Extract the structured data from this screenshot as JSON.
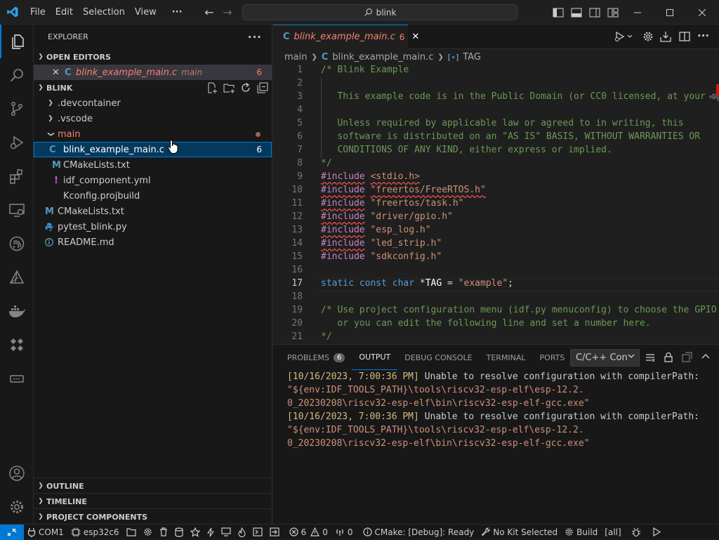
{
  "menu": {
    "file": "File",
    "edit": "Edit",
    "selection": "Selection",
    "view": "View",
    "more": "···"
  },
  "search": {
    "text": "blink"
  },
  "explorer": {
    "title": "EXPLORER",
    "open_editors": {
      "title": "OPEN EDITORS",
      "file": {
        "name": "blink_example_main.c",
        "folder": "main",
        "problems": "6"
      }
    },
    "folder": {
      "title": "BLINK"
    },
    "tree": [
      {
        "label": ".devcontainer"
      },
      {
        "label": ".vscode"
      },
      {
        "label": "main"
      },
      {
        "label": "blink_example_main.c",
        "badge": "6"
      },
      {
        "label": "CMakeLists.txt"
      },
      {
        "label": "idf_component.yml"
      },
      {
        "label": "Kconfig.projbuild"
      },
      {
        "label": "CMakeLists.txt"
      },
      {
        "label": "pytest_blink.py"
      },
      {
        "label": "README.md"
      }
    ],
    "outline": "OUTLINE",
    "timeline": "TIMELINE",
    "project_components": "PROJECT COMPONENTS"
  },
  "editor": {
    "tab": {
      "name": "blink_example_main.c",
      "problems": "6"
    },
    "breadcrumb": {
      "folder": "main",
      "file": "blink_example_main.c",
      "symbol": "TAG"
    },
    "line_numbers": [
      "1",
      "2",
      "3",
      "4",
      "5",
      "6",
      "7",
      "8",
      "9",
      "10",
      "11",
      "12",
      "13",
      "14",
      "15",
      "16",
      "17",
      "18",
      "19",
      "20",
      "21"
    ],
    "code": {
      "l1": "/* Blink Example",
      "l3": "   This example code is in the Public Domain (or CC0 licensed, at your option.)",
      "l5": "   Unless required by applicable law or agreed to in writing, this",
      "l6": "   software is distributed on an \"AS IS\" BASIS, WITHOUT WARRANTIES OR",
      "l7": "   CONDITIONS OF ANY KIND, either express or implied.",
      "l8": "*/",
      "include": "#include",
      "inc9": "<stdio.h>",
      "inc10": "\"freertos/FreeRTOS.h\"",
      "inc11": "\"freertos/task.h\"",
      "inc12": "\"driver/gpio.h\"",
      "inc13": "\"esp_log.h\"",
      "inc14": "\"led_strip.h\"",
      "inc15": "\"sdkconfig.h\"",
      "l17_static": "static",
      "l17_const": "const",
      "l17_char": "char",
      "l17_star": " *",
      "l17_var": "TAG",
      "l17_eq": " = ",
      "l17_str": "\"example\"",
      "l17_semi": ";",
      "l19": "/* Use project configuration menu (idf.py menuconfig) to choose the GPIO to blink,",
      "l20": "   or you can edit the following line and set a number here.",
      "l21": "*/"
    }
  },
  "panel": {
    "tabs": {
      "problems": "PROBLEMS",
      "problems_count": "6",
      "output": "OUTPUT",
      "debug_console": "DEBUG CONSOLE",
      "terminal": "TERMINAL",
      "ports": "PORTS"
    },
    "channel": "C/C++ Con",
    "output": {
      "l1_ts": "[10/16/2023, 7:00:36 PM]",
      "l1_msg": " Unable to resolve configuration with compilerPath:",
      "l2": "\"${env:IDF_TOOLS_PATH}\\tools\\riscv32-esp-elf\\esp-12.2.",
      "l3": "0_20230208\\riscv32-esp-elf\\bin\\riscv32-esp-elf-gcc.exe\"",
      "l4_ts": "[10/16/2023, 7:00:36 PM]",
      "l4_msg": " Unable to resolve configuration with compilerPath:",
      "l5": "\"${env:IDF_TOOLS_PATH}\\tools\\riscv32-esp-elf\\esp-12.2.",
      "l6": "0_20230208\\riscv32-esp-elf\\bin\\riscv32-esp-elf-gcc.exe\""
    }
  },
  "status": {
    "port": "COM1",
    "target": "esp32c6",
    "errors": "6",
    "warnings": "0",
    "info": "0",
    "cmake": "CMake: [Debug]: Ready",
    "kit": "No Kit Selected",
    "build": "Build",
    "all": "[all]"
  },
  "colors": {
    "accent": "#0078d4",
    "error": "#f14c4c",
    "modified_file": "#f88070",
    "c_icon": "#519aba",
    "cmake_icon": "#519aba",
    "yml_icon": "#cb56e8",
    "python_icon": "#3572a5",
    "info_icon": "#519aba"
  }
}
